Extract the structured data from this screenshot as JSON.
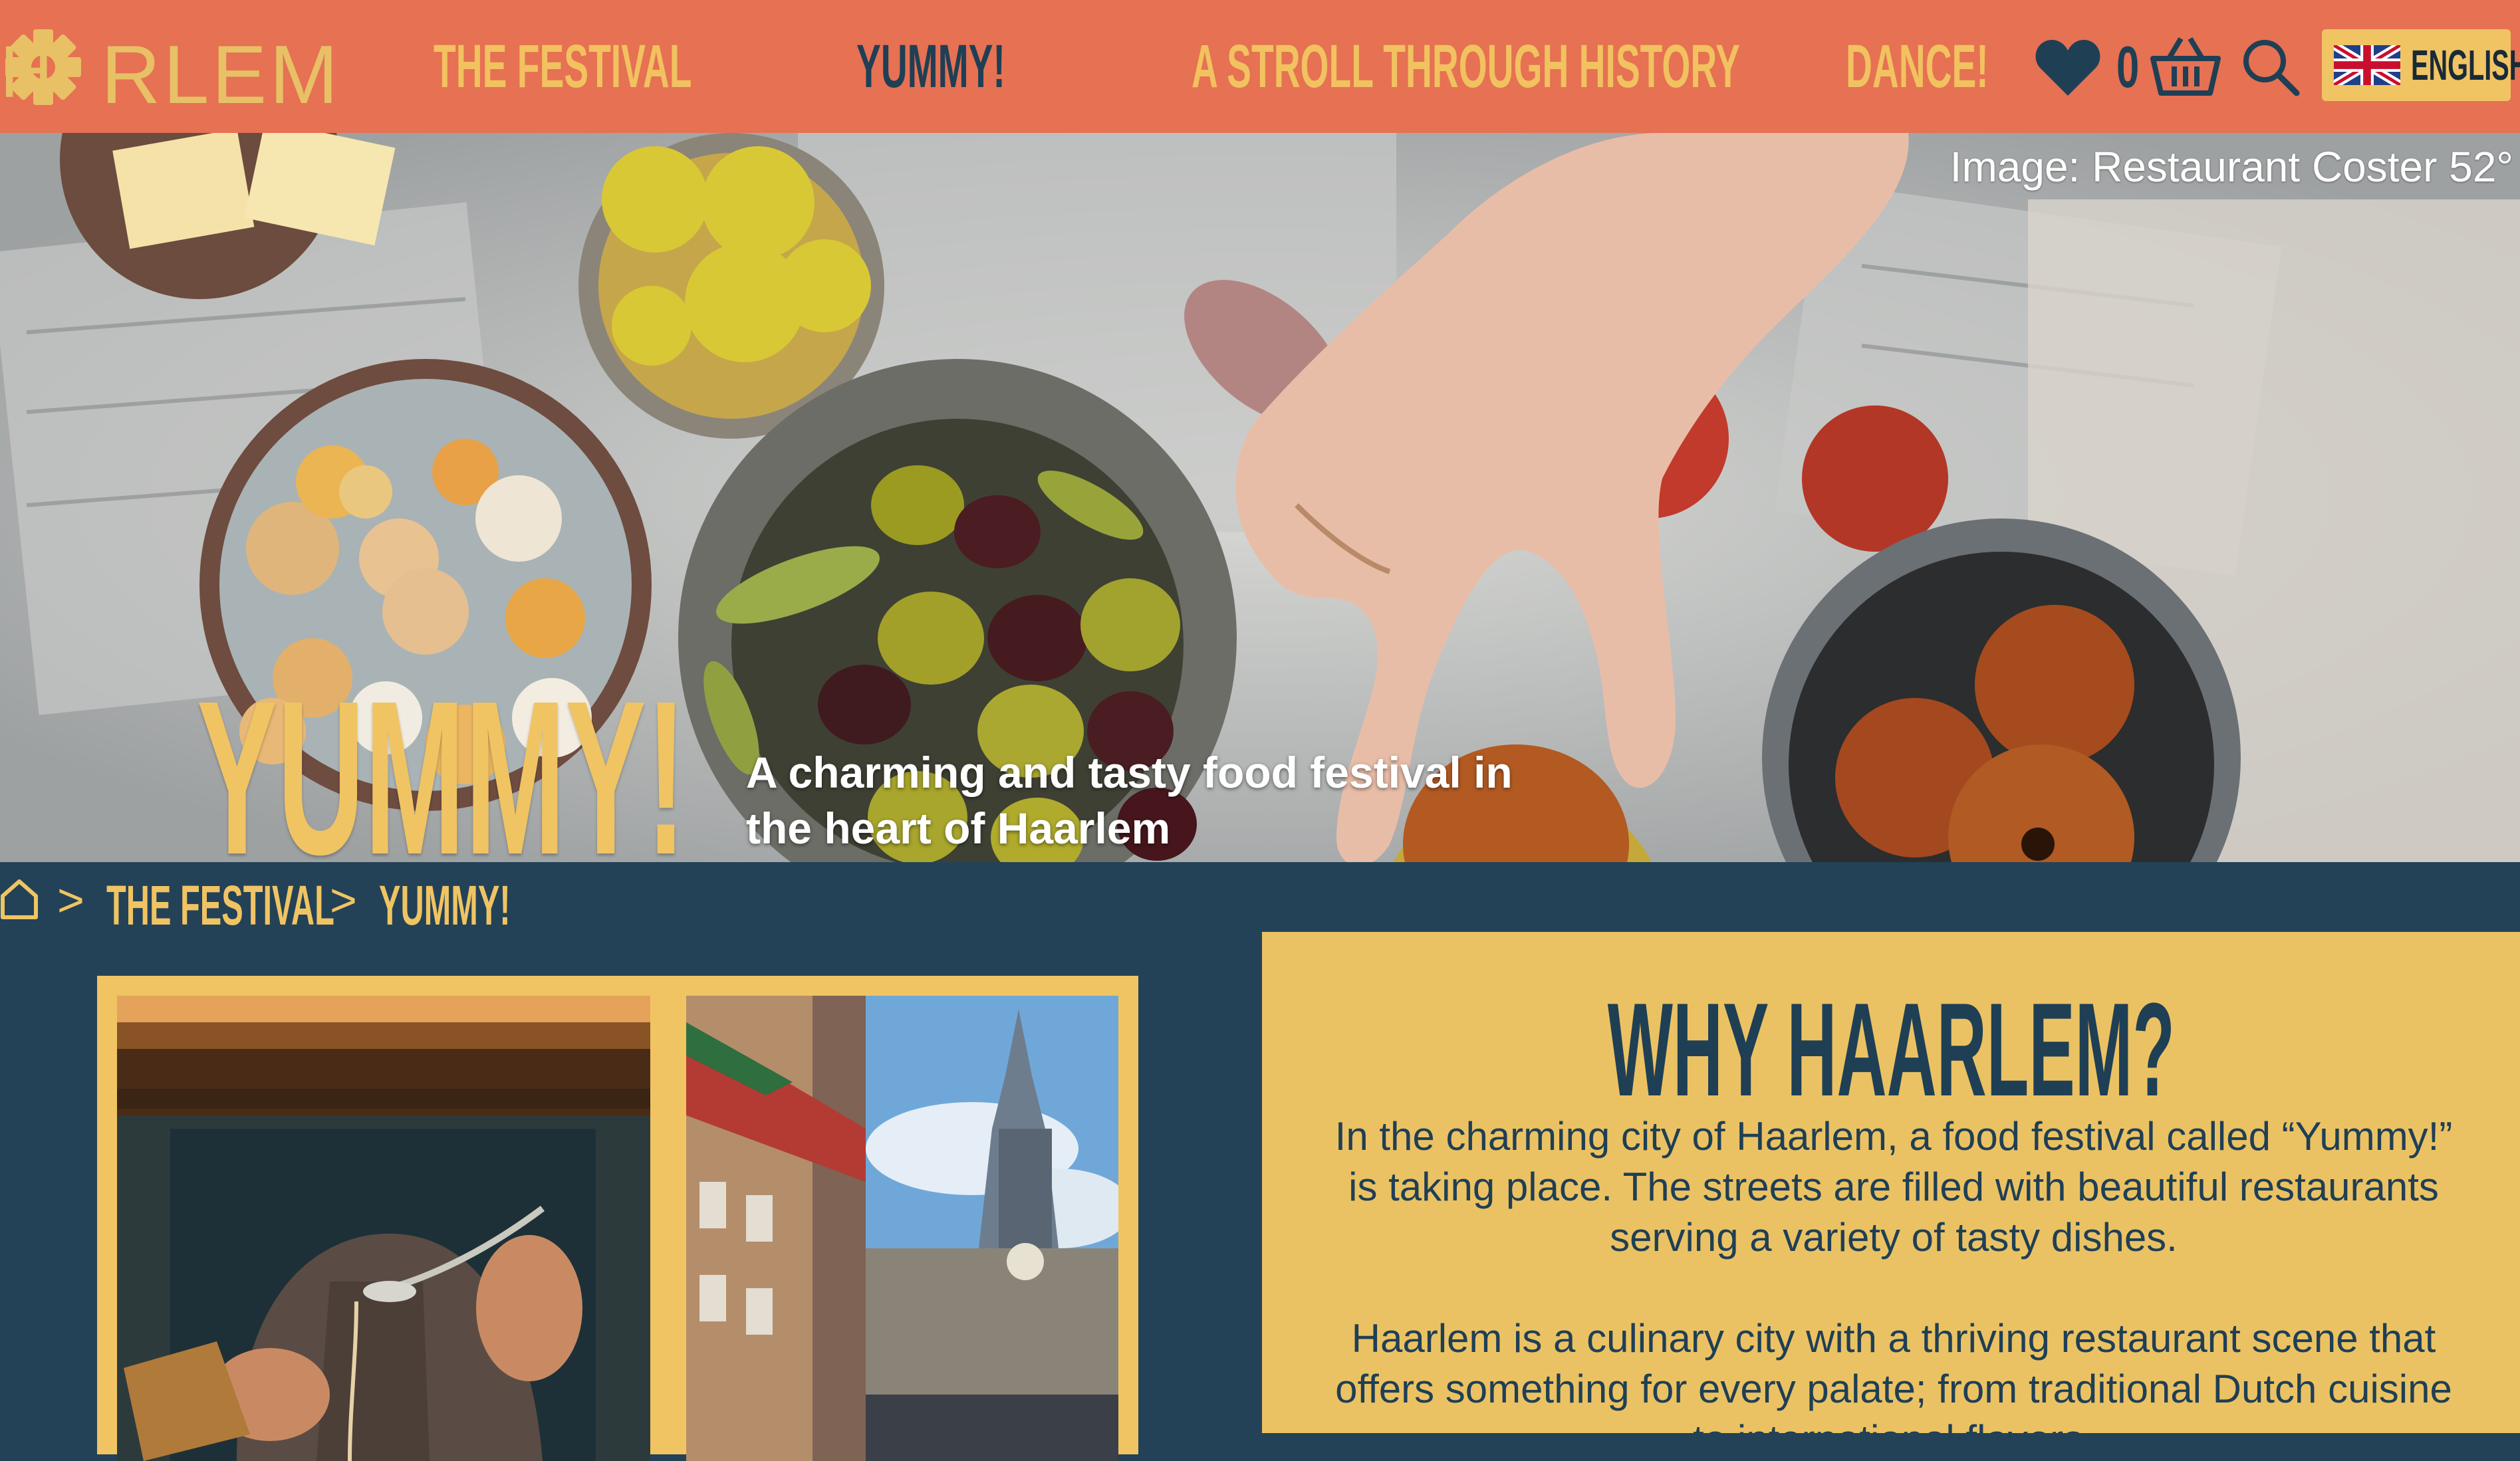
{
  "nav": {
    "logo_text": "RLEM",
    "items": [
      {
        "label": "THE FESTIVAL",
        "active": false
      },
      {
        "label": "YUMMY!",
        "active": true
      },
      {
        "label": "A STROLL THROUGH HISTORY",
        "active": false
      },
      {
        "label": "DANCE!",
        "active": false
      }
    ],
    "cart_count": "0",
    "language": "ENGLISH",
    "icons": [
      "heart-icon",
      "basket-icon",
      "search-icon",
      "uk-flag-icon"
    ]
  },
  "hero": {
    "credit": "Image:  Restaurant Coster 52°",
    "title": "YUMMY!",
    "subtitle": "A charming and tasty food festival in the heart of Haarlem"
  },
  "breadcrumb": {
    "separator": ">",
    "items": [
      "THE FESTIVAL",
      "YUMMY!"
    ]
  },
  "why": {
    "title": "WHY HAARLEM?",
    "paragraph1": "In the charming city of Haarlem, a food festival called “Yummy!” is taking place. The streets are filled with beautiful restaurants serving a variety of tasty dishes.",
    "paragraph2": "Haarlem is a culinary city with a thriving restaurant scene that offers something for every palate; from traditional Dutch cuisine to international flavors."
  },
  "colors": {
    "nav_bg": "#e67153",
    "accent_yellow": "#f0c463",
    "dark_navy": "#234257",
    "panel_yellow": "#ebc263"
  }
}
